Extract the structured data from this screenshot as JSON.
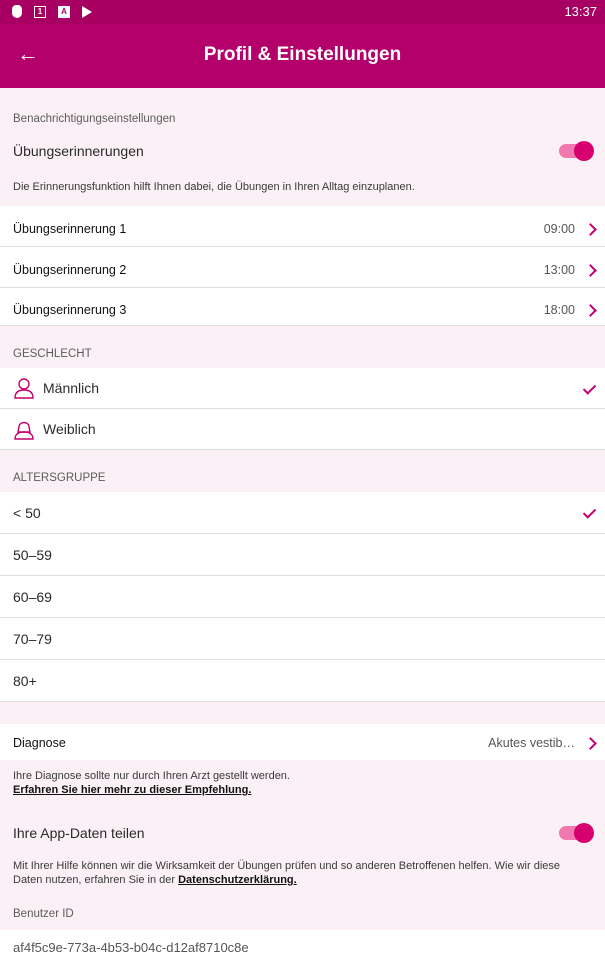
{
  "status_bar": {
    "time": "13:37"
  },
  "app_bar": {
    "title": "Profil & Einstellungen"
  },
  "notifications": {
    "section_label": "Benachrichtigungseinstellungen",
    "toggle_label": "Übungserinnerungen",
    "toggle_on": true,
    "hint": "Die Erinnerungsfunktion hilft Ihnen dabei, die Übungen in Ihren Alltag einzuplanen.",
    "reminders": [
      {
        "label": "Übungserinnerung 1",
        "time": "09:00"
      },
      {
        "label": "Übungserinnerung 2",
        "time": "13:00"
      },
      {
        "label": "Übungserinnerung 3",
        "time": "18:00"
      }
    ]
  },
  "gender": {
    "section_label": "GESCHLECHT",
    "options": [
      {
        "label": "Männlich",
        "selected": true
      },
      {
        "label": "Weiblich",
        "selected": false
      }
    ]
  },
  "age_group": {
    "section_label": "ALTERSGRUPPE",
    "options": [
      {
        "label": "< 50",
        "selected": true
      },
      {
        "label": "50–59",
        "selected": false
      },
      {
        "label": "60–69",
        "selected": false
      },
      {
        "label": "70–79",
        "selected": false
      },
      {
        "label": "80+",
        "selected": false
      }
    ]
  },
  "diagnosis": {
    "label": "Diagnose",
    "value": "Akutes vestib…",
    "hint": "Ihre Diagnose sollte nur durch Ihren Arzt gestellt werden.",
    "link": "Erfahren Sie hier mehr zu dieser Empfehlung."
  },
  "share": {
    "label": "Ihre App-Daten teilen",
    "toggle_on": true,
    "hint": "Mit Ihrer Hilfe können wir die Wirksamkeit der Übungen prüfen und so anderen Betroffenen helfen. Wie wir diese Daten nutzen, erfahren Sie in der",
    "link": "Datenschutzerklärung."
  },
  "user": {
    "label": "Benutzer ID",
    "id": "af4f5c9e-773a-4b53-b04c-d12af8710c8e"
  },
  "colors": {
    "primary": "#b3006a",
    "accent": "#d6006f",
    "section_bg": "#fbf0f5"
  }
}
